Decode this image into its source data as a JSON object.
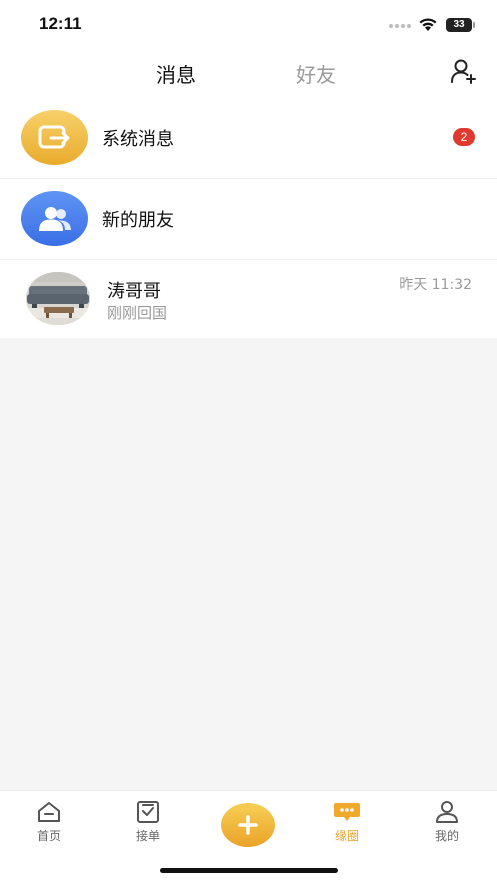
{
  "status_bar": {
    "time": "12:11",
    "battery": "33"
  },
  "header": {
    "tabs": [
      "消息",
      "好友"
    ],
    "active_tab": "消息",
    "add_friend_icon": "person-add-icon"
  },
  "list": {
    "system": {
      "title": "系统消息",
      "badge": "2",
      "icon": "system-message-icon",
      "icon_color": "#eeb83c"
    },
    "new_friends": {
      "title": "新的朋友",
      "icon": "users-icon",
      "icon_color": "#4a7cf0"
    },
    "chats": [
      {
        "name": "涛哥哥",
        "preview": "刚刚回国",
        "time": "昨天 11:32"
      }
    ]
  },
  "tabbar": {
    "items": [
      {
        "label": "首页",
        "icon": "home-icon"
      },
      {
        "label": "接单",
        "icon": "order-check-icon"
      },
      {
        "label": "",
        "icon": "plus-icon"
      },
      {
        "label": "缘圈",
        "icon": "chat-bubble-icon",
        "active": true
      },
      {
        "label": "我的",
        "icon": "profile-icon"
      }
    ],
    "accent_color": "#e9a42c"
  }
}
